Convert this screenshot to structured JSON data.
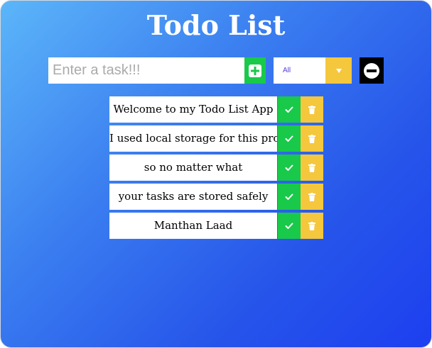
{
  "app": {
    "title": "Todo List"
  },
  "input": {
    "placeholder": "Enter a task!!!",
    "value": ""
  },
  "filter": {
    "selected": "All"
  },
  "icons": {
    "add": "plus-square-icon",
    "dropdown": "caret-down-icon",
    "clear": "minus-circle-icon",
    "complete": "check-icon",
    "delete": "trash-icon"
  },
  "colors": {
    "gradient_start": "#5cb6f9",
    "gradient_end": "#1d3ff0",
    "check_green": "#19c94a",
    "trash_yellow": "#f4c73d",
    "filter_text": "#5a39d6"
  },
  "todos": [
    {
      "text": "Welcome to my Todo List App"
    },
    {
      "text": "I used local storage for this projekt"
    },
    {
      "text": "so no matter what"
    },
    {
      "text": "your tasks are stored safely"
    },
    {
      "text": "Manthan Laad"
    }
  ]
}
